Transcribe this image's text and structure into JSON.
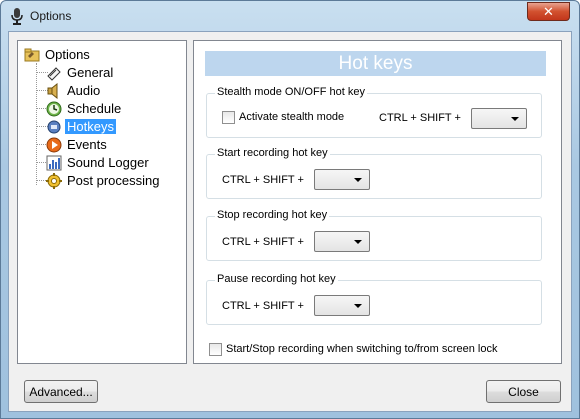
{
  "window": {
    "title": "Options",
    "close_glyph": "✕"
  },
  "tree": {
    "root_label": "Options",
    "items": [
      {
        "label": "General",
        "icon": "general-icon"
      },
      {
        "label": "Audio",
        "icon": "audio-icon"
      },
      {
        "label": "Schedule",
        "icon": "schedule-icon"
      },
      {
        "label": "Hotkeys",
        "icon": "hotkeys-icon",
        "selected": true
      },
      {
        "label": "Events",
        "icon": "events-icon"
      },
      {
        "label": "Sound Logger",
        "icon": "sound-logger-icon"
      },
      {
        "label": "Post processing",
        "icon": "post-processing-icon"
      }
    ]
  },
  "panel": {
    "header": "Hot keys",
    "stealth": {
      "title": "Stealth mode ON/OFF hot key",
      "checkbox_label": "Activate stealth mode",
      "modifier": "CTRL + SHIFT +",
      "value": ""
    },
    "start": {
      "title": "Start recording hot key",
      "modifier": "CTRL + SHIFT +",
      "value": ""
    },
    "stop": {
      "title": "Stop recording hot key",
      "modifier": "CTRL + SHIFT +",
      "value": ""
    },
    "pause": {
      "title": "Pause recording hot key",
      "modifier": "CTRL + SHIFT +",
      "value": ""
    },
    "screen_lock_label": "Start/Stop recording when switching to/from screen lock"
  },
  "buttons": {
    "advanced": "Advanced...",
    "close": "Close"
  }
}
